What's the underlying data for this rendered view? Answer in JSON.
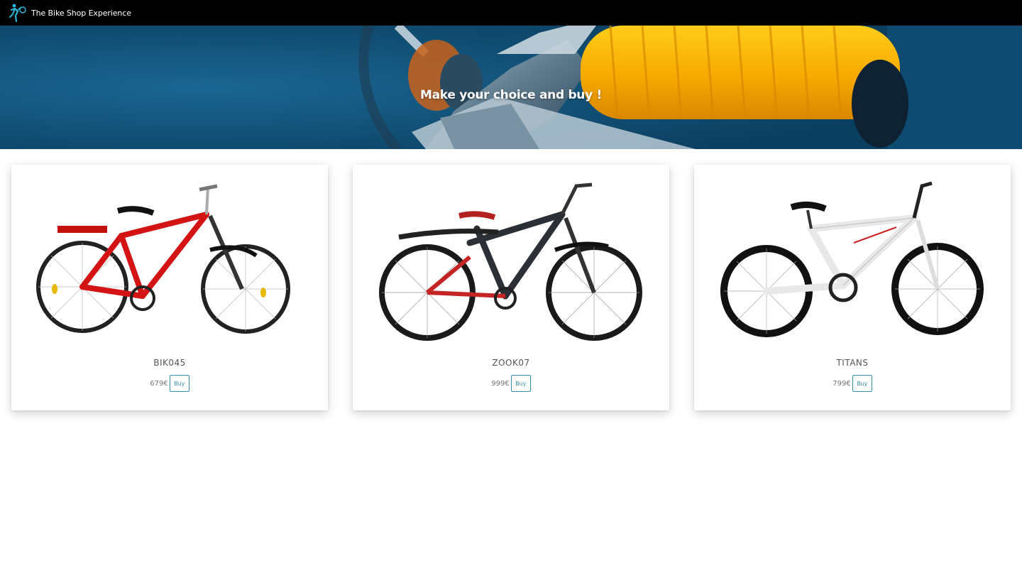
{
  "navbar": {
    "brand_name": "The Bike Shop Experience",
    "logo_icon": "bike-rider-logo-icon",
    "background": "#000000",
    "logo_color": "#2bb7d6"
  },
  "hero": {
    "title": "Make your choice and buy !",
    "image": "bike-handlebar-grip-photo"
  },
  "products": [
    {
      "name": "BIK045",
      "price": "679€",
      "buy_label": "Buy",
      "image": "red-bicycle-photo"
    },
    {
      "name": "ZOOK07",
      "price": "999€",
      "buy_label": "Buy",
      "image": "black-red-bicycle-photo"
    },
    {
      "name": "TITANS",
      "price": "799€",
      "buy_label": "Buy",
      "image": "white-bicycle-photo"
    }
  ],
  "colors": {
    "accent": "#3a8fa8",
    "hero_blue": "#135a85",
    "grip_yellow": "#f7b500"
  }
}
